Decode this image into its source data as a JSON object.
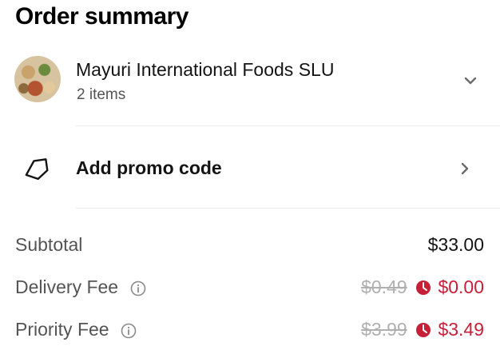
{
  "header": {
    "title": "Order summary"
  },
  "store": {
    "name": "Mayuri International Foods SLU",
    "items_count": "2 items"
  },
  "promo": {
    "label": "Add promo code"
  },
  "fees": [
    {
      "label": "Subtotal",
      "value": "$33.00"
    },
    {
      "label": "Delivery Fee",
      "original": "$0.49",
      "value": "$0.00"
    },
    {
      "label": "Priority Fee",
      "original": "$3.99",
      "value": "$3.49"
    }
  ],
  "colors": {
    "promo_red": "#c71f37",
    "strike_gray": "#b0b0b0",
    "secondary_text": "#545454"
  },
  "icons": [
    "chevron-down-icon",
    "tag-icon",
    "chevron-right-icon",
    "info-icon",
    "promo-badge-icon"
  ]
}
